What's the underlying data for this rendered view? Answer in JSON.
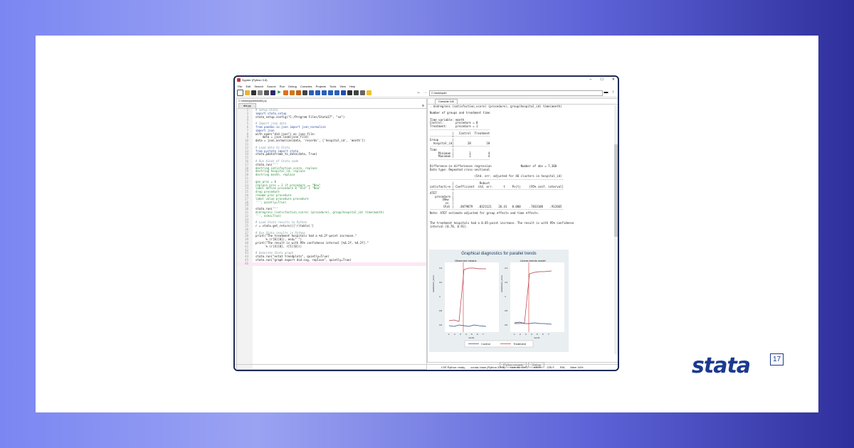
{
  "window": {
    "title": "Spyder (Python 3.8)"
  },
  "menu": [
    "File",
    "Edit",
    "Search",
    "Source",
    "Run",
    "Debug",
    "Consoles",
    "Projects",
    "Tools",
    "View",
    "Help"
  ],
  "toolbar": {
    "path": "C:\\stata\\pdb"
  },
  "editor": {
    "path": "C:\\stata\\pystata\\did.py",
    "tab": "did.py",
    "lines": [
      {
        "n": "1",
        "t": "# Setup Stata",
        "k": "comment"
      },
      {
        "n": "2",
        "t": "import stata_setup",
        "k": "kw"
      },
      {
        "n": "3",
        "t": "stata_setup.config(\"C:/Program Files/Stata17\", \"se\")",
        "k": "plain"
      },
      {
        "n": "4",
        "t": "",
        "k": "plain"
      },
      {
        "n": "5",
        "t": "# Import json data",
        "k": "comment"
      },
      {
        "n": "6",
        "t": "from pandas.io.json import json_normalize",
        "k": "kw"
      },
      {
        "n": "7",
        "t": "import json",
        "k": "kw"
      },
      {
        "n": "8",
        "t": "with open(\"did.json\") as json_file:",
        "k": "plain"
      },
      {
        "n": "9",
        "t": "    data = json.load(json_file)",
        "k": "plain"
      },
      {
        "n": "10",
        "t": "data = json_normalize(data, 'records', ['hospital_id', 'month'])",
        "k": "plain"
      },
      {
        "n": "11",
        "t": "",
        "k": "plain"
      },
      {
        "n": "12",
        "t": "# Load data to Stata",
        "k": "comment"
      },
      {
        "n": "13",
        "t": "from pystata import stata",
        "k": "kw"
      },
      {
        "n": "14",
        "t": "stata.pdataframe_to_data(data, True)",
        "k": "plain"
      },
      {
        "n": "15",
        "t": "",
        "k": "plain"
      },
      {
        "n": "16",
        "t": "# Run block of Stata code",
        "k": "comment"
      },
      {
        "n": "17",
        "t": "stata.run('''",
        "k": "plain"
      },
      {
        "n": "18",
        "t": "destring satisfaction_score, replace",
        "k": "str"
      },
      {
        "n": "19",
        "t": "destring hospital_id, replace",
        "k": "str"
      },
      {
        "n": "20",
        "t": "destring month, replace",
        "k": "str"
      },
      {
        "n": "21",
        "t": "",
        "k": "plain"
      },
      {
        "n": "22",
        "t": "gen proc = 0",
        "k": "str"
      },
      {
        "n": "23",
        "t": "replace proc = 1 if procedure == \"New\"",
        "k": "str"
      },
      {
        "n": "24",
        "t": "label define procedure 0 \"Old\" 1 \"New\"",
        "k": "str"
      },
      {
        "n": "25",
        "t": "drop procedure",
        "k": "str"
      },
      {
        "n": "26",
        "t": "rename proc procedure",
        "k": "str"
      },
      {
        "n": "27",
        "t": "label value procedure procedure",
        "k": "str"
      },
      {
        "n": "28",
        "t": "''', quietly=True)",
        "k": "str"
      },
      {
        "n": "29",
        "t": "",
        "k": "plain"
      },
      {
        "n": "30",
        "t": "stata.run('''",
        "k": "plain"
      },
      {
        "n": "31",
        "t": "didregress (satisfaction_score) (procedure), group(hospital_id) time(month)",
        "k": "str"
      },
      {
        "n": "32",
        "t": "''', echo=True)",
        "k": "str"
      },
      {
        "n": "33",
        "t": "",
        "k": "plain"
      },
      {
        "n": "34",
        "t": "# Load Stata results to Python",
        "k": "comment"
      },
      {
        "n": "35",
        "t": "r = stata.get_return()['r(table)']",
        "k": "plain"
      },
      {
        "n": "36",
        "t": "",
        "k": "plain"
      },
      {
        "n": "37",
        "t": "# Use Stata results in Python",
        "k": "comment"
      },
      {
        "n": "38",
        "t": "print(\"The treatment hospitals had a %4.2f-point increase.\"",
        "k": "plain"
      },
      {
        "n": "39",
        "t": "      % (r[0][0]), end=\" \")",
        "k": "plain"
      },
      {
        "n": "40",
        "t": "print(\"The result is with 95% confidence interval [%4.2f, %4.2f].\"",
        "k": "plain"
      },
      {
        "n": "41",
        "t": "      % (r[4][0], r[5][0]))",
        "k": "plain"
      },
      {
        "n": "42",
        "t": "",
        "k": "plain"
      },
      {
        "n": "43",
        "t": "# Generate Stata graph",
        "k": "comment"
      },
      {
        "n": "44",
        "t": "stata.run(\"estat trendplots\", quietly=True)",
        "k": "plain"
      },
      {
        "n": "45",
        "t": "stata.run(\"graph export did.svg, replace\", quietly=True)",
        "k": "plain"
      },
      {
        "n": "46",
        "t": "",
        "k": "plain"
      }
    ]
  },
  "console": {
    "tab": "Console 1/A",
    "lines": [
      ". didregress (satisfaction_score) (procedure), group(hospital_id) time(month)",
      "",
      "Number of groups and treatment time",
      "",
      "Time variable: month",
      "Control:       procedure = 0",
      "Treatment:     procedure = 1",
      "-----------------------------------",
      "             |   Control  Treatment",
      "-------------+---------------------",
      "Group        |",
      "  hospital_id|        28         18",
      "-------------+---------------------",
      "Time         |",
      "     Minimum |         1          4",
      "     Maximum |         1          4",
      "-----------------------------------",
      "",
      "Difference-in-differences regression                 Number of obs = 7,368",
      "Data type: Repeated cross-sectional",
      "",
      "                          (Std. err. adjusted for 46 clusters in hospital_id)",
      "------------------------------------------------------------------------------",
      "             |               Robust",
      "satisfacti~e | Coefficient  std. err.      t    P>|t|     [95% conf. interval]",
      "-------------+----------------------------------------------------------------",
      "ATET         |",
      "   procedure |",
      "       (New  |",
      "         vs  |",
      "        Old) |   .8479879   .0321121    26.41   0.000     .7833108    .912665",
      "------------------------------------------------------------------------------",
      "Note: ATET estimate adjusted for group effects and time effects.",
      "",
      "",
      "The treatment hospitals had a 0.85-point increase. The result is with 95% confidence",
      "interval [0.78, 0.91]."
    ],
    "graph": {
      "title": "Graphical diagnostics for parallel trends",
      "panel1": "Observed means",
      "panel2": "Linear-trends model",
      "ylabel": "satisfaction_score",
      "xlabel": "month",
      "yticks": [
        "4.4",
        "4.2",
        "4",
        "3.8",
        "3.6"
      ],
      "xticks": [
        "1",
        "2",
        "3",
        "4",
        "5",
        "6",
        "7"
      ],
      "legend": [
        "Control",
        "Treatment"
      ]
    }
  },
  "bottom_tabs": [
    "IPython console",
    "History"
  ],
  "status": [
    "LSP Python: ready",
    "conda: base (Python 3.8.5)",
    "Line 46, Col 1",
    "ASCII",
    "CRLF",
    "RW",
    "Mem 34%"
  ],
  "brand": {
    "name": "stata",
    "version": "17"
  }
}
